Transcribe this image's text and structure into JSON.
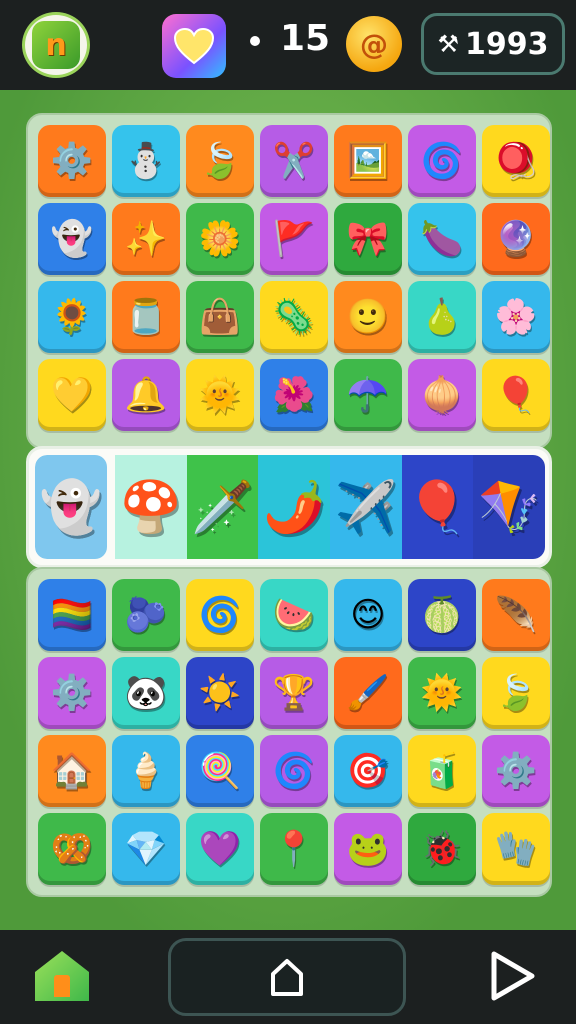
{
  "header": {
    "logo_letter": "n",
    "count": "15",
    "score": "1993"
  },
  "colors": {
    "board_green": "#5ca844",
    "panel": "#c5dfc0",
    "bar": "#1c2020"
  },
  "top_grid": [
    {
      "bg": "#ff7a1c",
      "icon": "⚙️",
      "name": "gear"
    },
    {
      "bg": "#35c3ec",
      "icon": "⛄",
      "name": "snowman"
    },
    {
      "bg": "#ff8a1e",
      "icon": "🍃",
      "name": "leaf"
    },
    {
      "bg": "#b65ce6",
      "icon": "✂️",
      "name": "crossed-tools"
    },
    {
      "bg": "#ff7a1c",
      "icon": "🖼️",
      "name": "frame"
    },
    {
      "bg": "#c35be6",
      "icon": "🌀",
      "name": "spiral"
    },
    {
      "bg": "#ffd91e",
      "icon": "🪀",
      "name": "yo-yo"
    },
    {
      "bg": "#2f80e8",
      "icon": "👻",
      "name": "ghost"
    },
    {
      "bg": "#ff7a1c",
      "icon": "✨",
      "name": "sparkle"
    },
    {
      "bg": "#3fb94a",
      "icon": "🌼",
      "name": "sun-flower"
    },
    {
      "bg": "#c35be6",
      "icon": "🚩",
      "name": "flag"
    },
    {
      "bg": "#2fa93e",
      "icon": "🎀",
      "name": "bow"
    },
    {
      "bg": "#35c3ec",
      "icon": "🍆",
      "name": "eggplant"
    },
    {
      "bg": "#ff6a1c",
      "icon": "🔮",
      "name": "orb"
    },
    {
      "bg": "#35b8ec",
      "icon": "🌻",
      "name": "flower"
    },
    {
      "bg": "#ff7a1c",
      "icon": "🫙",
      "name": "jar"
    },
    {
      "bg": "#3fb94a",
      "icon": "👜",
      "name": "bag"
    },
    {
      "bg": "#ffd91e",
      "icon": "🦠",
      "name": "germ"
    },
    {
      "bg": "#ff8a1e",
      "icon": "🙂",
      "name": "face"
    },
    {
      "bg": "#38d7c6",
      "icon": "🍐",
      "name": "pear"
    },
    {
      "bg": "#35b8ec",
      "icon": "🌸",
      "name": "blossom"
    },
    {
      "bg": "#ffd91e",
      "icon": "💛",
      "name": "heart-balloon"
    },
    {
      "bg": "#b65ce6",
      "icon": "🔔",
      "name": "bell"
    },
    {
      "bg": "#ffd91e",
      "icon": "🌞",
      "name": "sun"
    },
    {
      "bg": "#2f80e8",
      "icon": "🌺",
      "name": "hibiscus"
    },
    {
      "bg": "#3fb94a",
      "icon": "☂️",
      "name": "umbrella"
    },
    {
      "bg": "#c35be6",
      "icon": "🧅",
      "name": "onion"
    },
    {
      "bg": "#ffd91e",
      "icon": "🎈",
      "name": "balloon"
    }
  ],
  "strip": [
    {
      "bg": "#7fc7ee",
      "icon": "👻",
      "name": "crowned-ghost"
    },
    {
      "bg": "#b7f2e0",
      "icon": "🍄",
      "name": "mushroom"
    },
    {
      "bg": "#3fc24a",
      "icon": "🗡️",
      "name": "sword"
    },
    {
      "bg": "#2bc4d9",
      "icon": "🌶️",
      "name": "pepper"
    },
    {
      "bg": "#35b8ec",
      "icon": "✈️",
      "name": "plane"
    },
    {
      "bg": "#2d45c8",
      "icon": "🎈",
      "name": "red-balloon"
    },
    {
      "bg": "#2a3fb8",
      "icon": "🪁",
      "name": "kite"
    }
  ],
  "bottom_grid": [
    {
      "bg": "#2f80e8",
      "icon": "🏳️‍🌈",
      "name": "rainbow-flag"
    },
    {
      "bg": "#3fb94a",
      "icon": "🫐",
      "name": "berry"
    },
    {
      "bg": "#ffd91e",
      "icon": "🌀",
      "name": "flower-ring"
    },
    {
      "bg": "#38d7c6",
      "icon": "🍉",
      "name": "melon"
    },
    {
      "bg": "#35b8ec",
      "icon": "😊",
      "name": "smiley"
    },
    {
      "bg": "#2d45c8",
      "icon": "🍈",
      "name": "lime"
    },
    {
      "bg": "#ff7a1c",
      "icon": "🪶",
      "name": "feather"
    },
    {
      "bg": "#c35be6",
      "icon": "⚙️",
      "name": "cog"
    },
    {
      "bg": "#38d7c6",
      "icon": "🐼",
      "name": "panda"
    },
    {
      "bg": "#2d45c8",
      "icon": "☀️",
      "name": "sunburst"
    },
    {
      "bg": "#b65ce6",
      "icon": "🏆",
      "name": "trophy"
    },
    {
      "bg": "#ff6a1c",
      "icon": "🖌️",
      "name": "brush"
    },
    {
      "bg": "#3fb94a",
      "icon": "🌞",
      "name": "sun-face"
    },
    {
      "bg": "#ffd91e",
      "icon": "🍃",
      "name": "blue-leaf"
    },
    {
      "bg": "#ff8a1e",
      "icon": "🏠",
      "name": "house"
    },
    {
      "bg": "#35b8ec",
      "icon": "🍦",
      "name": "ice-cream"
    },
    {
      "bg": "#2f80e8",
      "icon": "🍭",
      "name": "lollipop"
    },
    {
      "bg": "#b65ce6",
      "icon": "🌀",
      "name": "swirl"
    },
    {
      "bg": "#35b8ec",
      "icon": "🎯",
      "name": "target"
    },
    {
      "bg": "#ffd91e",
      "icon": "🧃",
      "name": "juice"
    },
    {
      "bg": "#c35be6",
      "icon": "⚙️",
      "name": "gear-gem"
    },
    {
      "bg": "#3fb94a",
      "icon": "🥨",
      "name": "pretzel"
    },
    {
      "bg": "#35b8ec",
      "icon": "💎",
      "name": "gem"
    },
    {
      "bg": "#38d7c6",
      "icon": "💜",
      "name": "heart"
    },
    {
      "bg": "#3fb94a",
      "icon": "📍",
      "name": "pin"
    },
    {
      "bg": "#c35be6",
      "icon": "🐸",
      "name": "frog"
    },
    {
      "bg": "#2fa93e",
      "icon": "🐞",
      "name": "bug"
    },
    {
      "bg": "#ffd91e",
      "icon": "🧤",
      "name": "glove"
    }
  ]
}
